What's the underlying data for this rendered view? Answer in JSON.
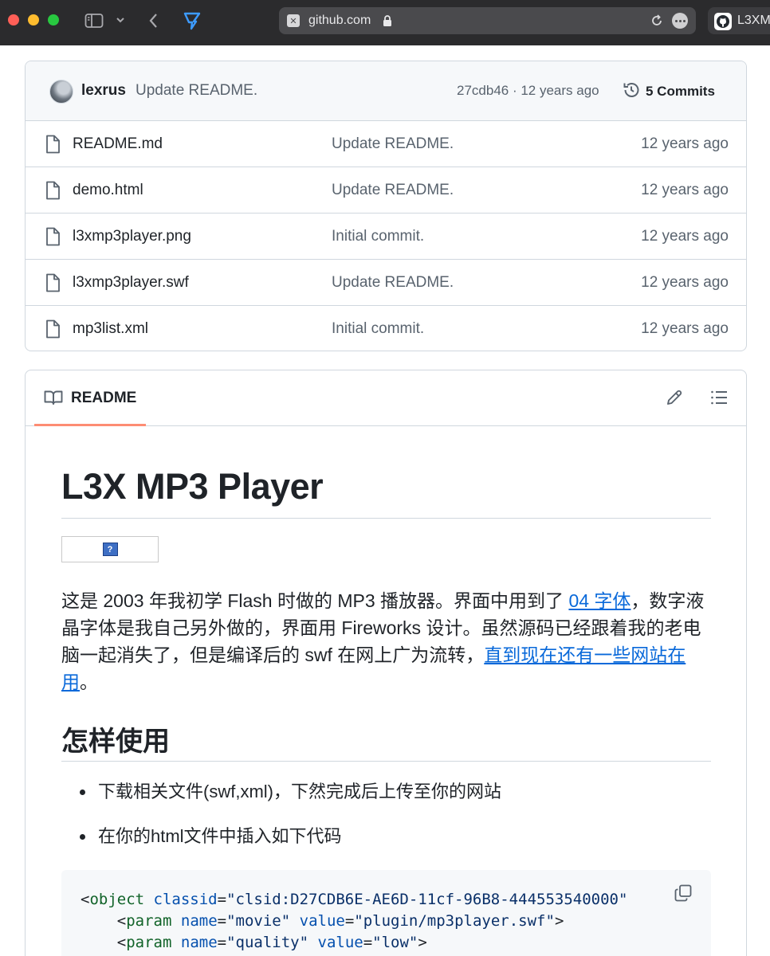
{
  "browser": {
    "address": "github.com",
    "tab_title": "L3XM",
    "icons": [
      "sidebar-icon",
      "chevron-down-icon",
      "back-icon",
      "extension-icon",
      "site-icon",
      "lock-icon",
      "reload-icon",
      "more-icon",
      "github-icon"
    ],
    "colors": {
      "toolbar": "#2b2b2d",
      "address_bar": "#4a4a4d"
    }
  },
  "repo": {
    "latest_commit": {
      "author": "lexrus",
      "message": "Update README.",
      "meta": "27cdb46 · 12 years ago",
      "commits_label": "5 Commits"
    },
    "files": [
      {
        "name": "README.md",
        "commit": "Update README.",
        "age": "12 years ago"
      },
      {
        "name": "demo.html",
        "commit": "Update README.",
        "age": "12 years ago"
      },
      {
        "name": "l3xmp3player.png",
        "commit": "Initial commit.",
        "age": "12 years ago"
      },
      {
        "name": "l3xmp3player.swf",
        "commit": "Update README.",
        "age": "12 years ago"
      },
      {
        "name": "mp3list.xml",
        "commit": "Initial commit.",
        "age": "12 years ago"
      }
    ]
  },
  "readme": {
    "tab_label": "README",
    "title": "L3X MP3 Player",
    "broken_image_glyph": "?",
    "intro": {
      "text_1": "这是 2003 年我初学 Flash 时做的 MP3 播放器。界面中用到了 ",
      "link_1": "04 字体",
      "text_2": "，数字液晶字体是我自己另外做的，界面用 Fireworks 设计。虽然源码已经跟着我的老电脑一起消失了，但是编译后的 swf 在网上广为流转，",
      "link_2": "直到现在还有一些网站在用",
      "text_3": "。"
    },
    "usage_heading": "怎样使用",
    "usage_items": [
      "下载相关文件(swf,xml)，下然完成后上传至你的网站",
      "在你的html文件中插入如下代码"
    ],
    "code": {
      "line1": {
        "open": "<",
        "tag": "object",
        "attr": "classid",
        "eq": "=",
        "value": "\"clsid:D27CDB6E-AE6D-11cf-96B8-444553540000\""
      },
      "line2": {
        "open": "<",
        "tag": "param",
        "attr1": "name",
        "value1": "\"movie\"",
        "attr2": "value",
        "value2": "\"plugin/mp3player.swf\"",
        "close": ">"
      },
      "line3": {
        "open": "<",
        "tag": "param",
        "attr1": "name",
        "value1": "\"quality\"",
        "attr2": "value",
        "value2": "\"low\"",
        "close": ">"
      }
    },
    "colors": {
      "link": "#0969da",
      "tab_underline": "#fd8c73",
      "code_bg": "#f6f8fa"
    }
  }
}
